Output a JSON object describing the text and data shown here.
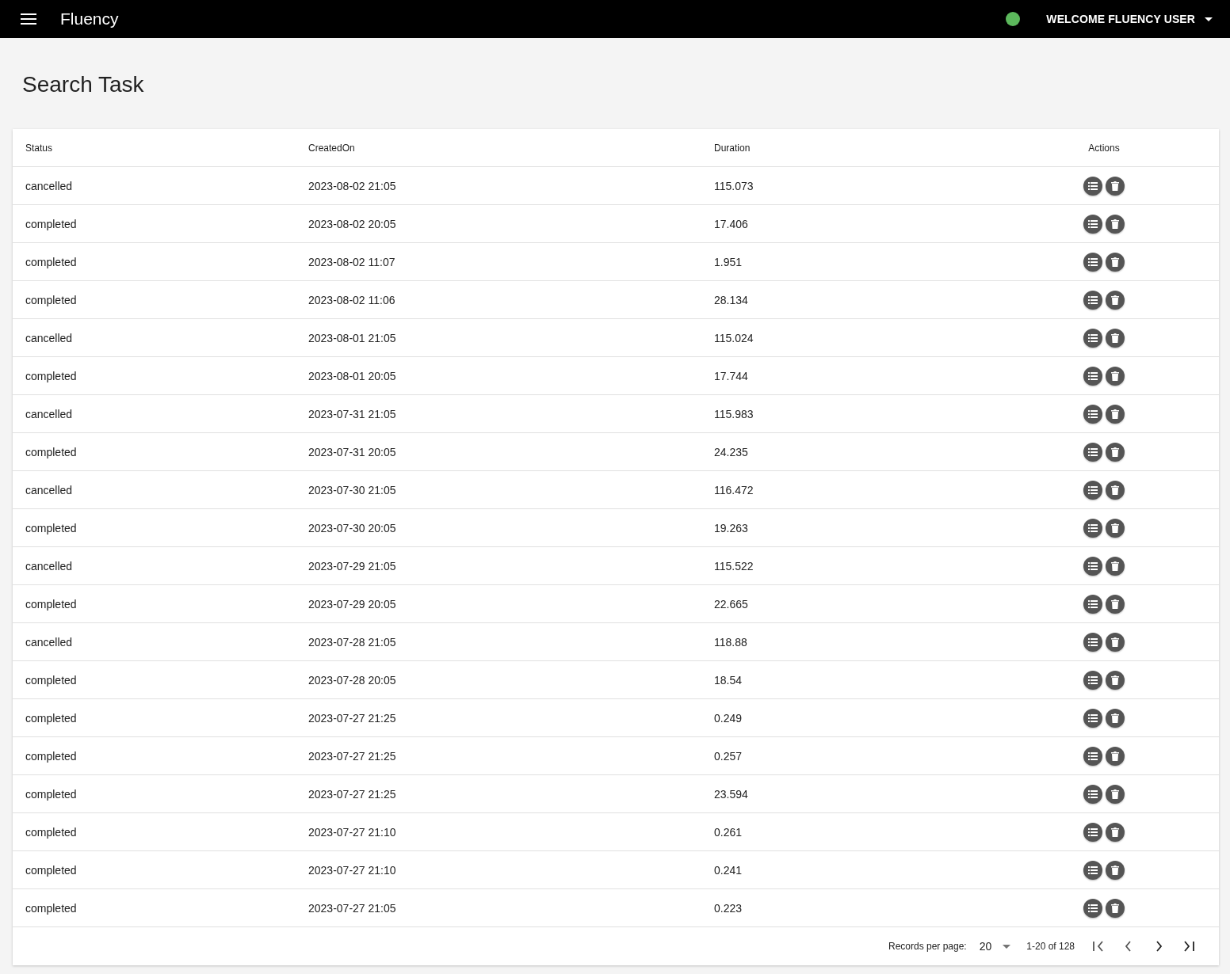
{
  "app_bar": {
    "title": "Fluency",
    "user_menu": "WELCOME FLUENCY USER"
  },
  "page_title": "Search Task",
  "table": {
    "columns": [
      "Status",
      "CreatedOn",
      "Duration",
      "Actions"
    ],
    "rows": [
      {
        "status": "cancelled",
        "created_on": "2023-08-02 21:05",
        "duration": "115.073"
      },
      {
        "status": "completed",
        "created_on": "2023-08-02 20:05",
        "duration": "17.406"
      },
      {
        "status": "completed",
        "created_on": "2023-08-02 11:07",
        "duration": "1.951"
      },
      {
        "status": "completed",
        "created_on": "2023-08-02 11:06",
        "duration": "28.134"
      },
      {
        "status": "cancelled",
        "created_on": "2023-08-01 21:05",
        "duration": "115.024"
      },
      {
        "status": "completed",
        "created_on": "2023-08-01 20:05",
        "duration": "17.744"
      },
      {
        "status": "cancelled",
        "created_on": "2023-07-31 21:05",
        "duration": "115.983"
      },
      {
        "status": "completed",
        "created_on": "2023-07-31 20:05",
        "duration": "24.235"
      },
      {
        "status": "cancelled",
        "created_on": "2023-07-30 21:05",
        "duration": "116.472"
      },
      {
        "status": "completed",
        "created_on": "2023-07-30 20:05",
        "duration": "19.263"
      },
      {
        "status": "cancelled",
        "created_on": "2023-07-29 21:05",
        "duration": "115.522"
      },
      {
        "status": "completed",
        "created_on": "2023-07-29 20:05",
        "duration": "22.665"
      },
      {
        "status": "cancelled",
        "created_on": "2023-07-28 21:05",
        "duration": "118.88"
      },
      {
        "status": "completed",
        "created_on": "2023-07-28 20:05",
        "duration": "18.54"
      },
      {
        "status": "completed",
        "created_on": "2023-07-27 21:25",
        "duration": "0.249"
      },
      {
        "status": "completed",
        "created_on": "2023-07-27 21:25",
        "duration": "0.257"
      },
      {
        "status": "completed",
        "created_on": "2023-07-27 21:25",
        "duration": "23.594"
      },
      {
        "status": "completed",
        "created_on": "2023-07-27 21:10",
        "duration": "0.261"
      },
      {
        "status": "completed",
        "created_on": "2023-07-27 21:10",
        "duration": "0.241"
      },
      {
        "status": "completed",
        "created_on": "2023-07-27 21:05",
        "duration": "0.223"
      }
    ]
  },
  "pagination": {
    "label": "Records per page:",
    "page_size": "20",
    "range": "1-20 of 128"
  }
}
